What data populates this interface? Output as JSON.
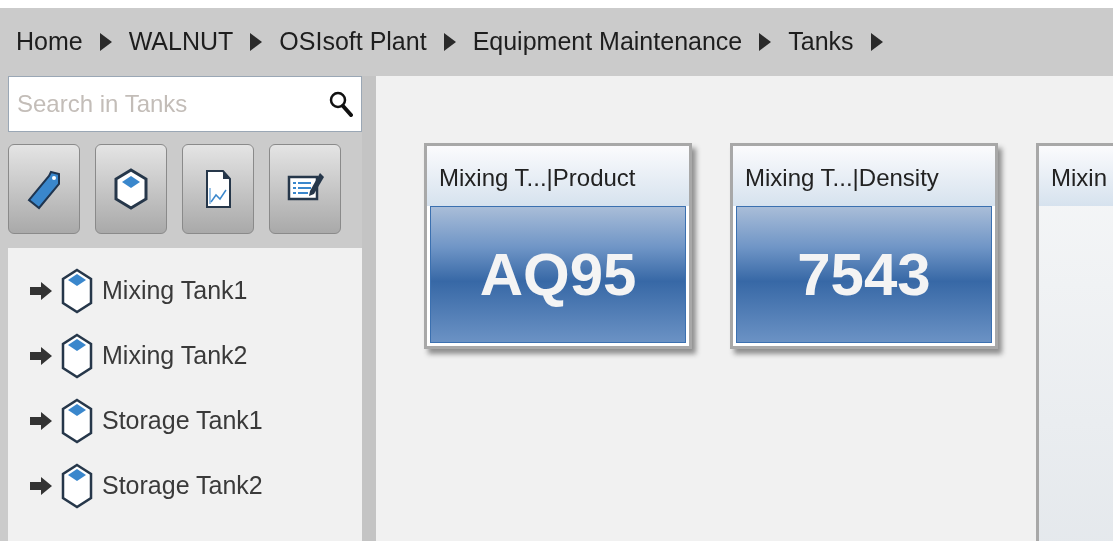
{
  "breadcrumb": [
    {
      "label": "Home"
    },
    {
      "label": "WALNUT"
    },
    {
      "label": "OSIsoft Plant"
    },
    {
      "label": "Equipment Maintenance"
    },
    {
      "label": "Tanks"
    }
  ],
  "search": {
    "placeholder": "Search in Tanks"
  },
  "toolbar": [
    {
      "kind": "tag"
    },
    {
      "kind": "element"
    },
    {
      "kind": "chart-doc"
    },
    {
      "kind": "list-edit"
    }
  ],
  "tree": [
    {
      "label": "Mixing Tank1"
    },
    {
      "label": "Mixing Tank2"
    },
    {
      "label": "Storage Tank1"
    },
    {
      "label": "Storage Tank2"
    }
  ],
  "tiles": [
    {
      "kind": "value",
      "title": "Mixing T...|Product",
      "value": "AQ95"
    },
    {
      "kind": "value",
      "title": "Mixing T...|Density",
      "value": "7543"
    },
    {
      "kind": "partial",
      "title": "Mixin"
    }
  ]
}
